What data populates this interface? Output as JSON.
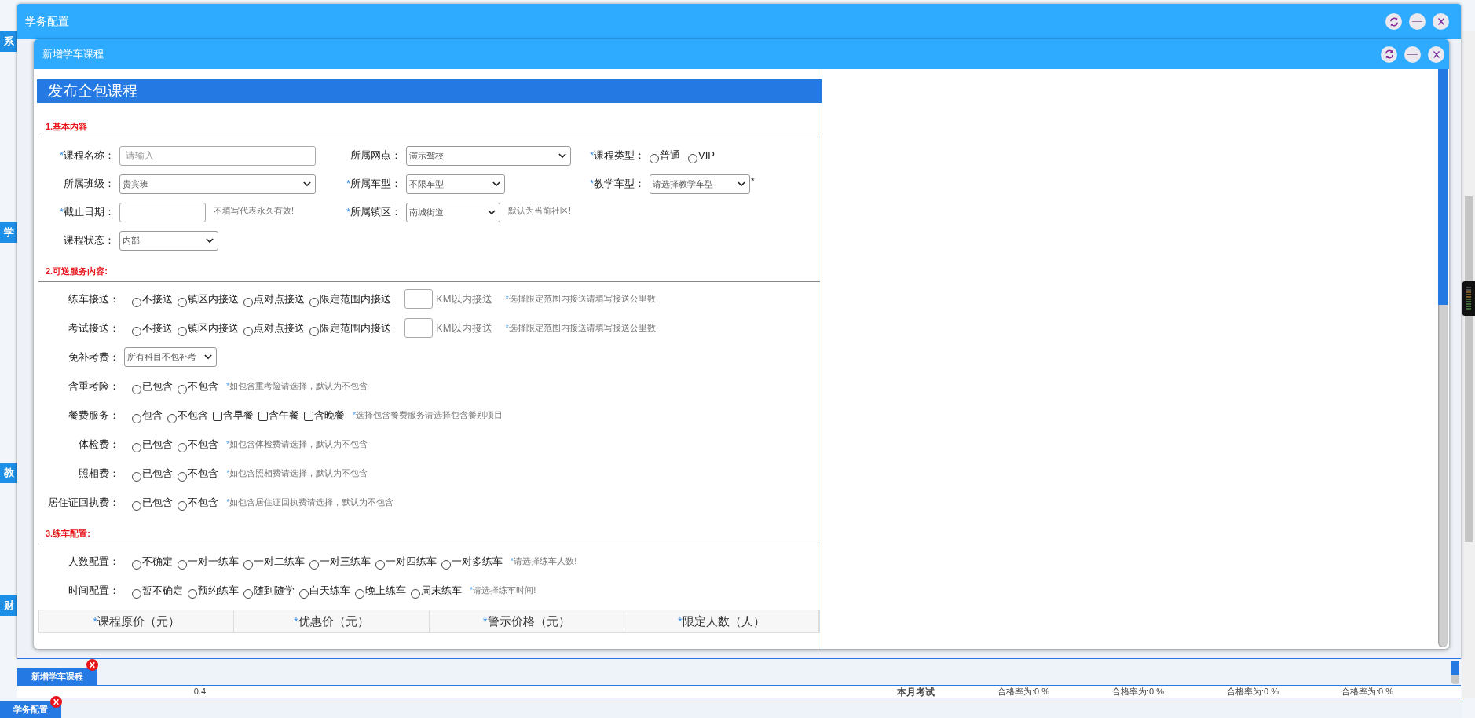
{
  "outer_window": {
    "title": "学务配置"
  },
  "inner_window": {
    "title": "新增学车课程",
    "heading": "发布全包课程",
    "sections": [
      {
        "title": "1.基本内容",
        "rows": [
          {
            "fields": [
              {
                "kind": "input",
                "mark": "*",
                "label": "课程名称：",
                "placeholder": "请输入"
              },
              {
                "kind": "select",
                "label": "所属网点：",
                "value": "演示驾校"
              },
              {
                "kind": "choice",
                "mark": "*",
                "label": "课程类型：",
                "options": [
                  {
                    "kind": "radio",
                    "label": "普通",
                    "selected": false
                  },
                  {
                    "kind": "radio",
                    "label": "VIP",
                    "selected": false
                  }
                ]
              }
            ]
          },
          {
            "fields": [
              {
                "kind": "select",
                "label": "所属班级：",
                "value": "贵宾班"
              },
              {
                "kind": "select",
                "mark": "*",
                "label": "所属车型：",
                "value": "不限车型"
              },
              {
                "kind": "select",
                "mark": "*",
                "label": "教学车型：",
                "value": "请选择教学车型",
                "suffix": "*"
              }
            ]
          },
          {
            "fields": [
              {
                "kind": "input",
                "mark": "*",
                "label": "截止日期：",
                "hint": {
                  "text": "不填写代表永久有效!"
                }
              },
              {
                "kind": "select",
                "mark": "*",
                "label": "所属镇区：",
                "value": "南城街道",
                "hint": {
                  "text": "默认为当前社区!"
                }
              }
            ]
          },
          {
            "fields": [
              {
                "kind": "select",
                "label": "课程状态：",
                "value": "内部"
              }
            ]
          }
        ]
      },
      {
        "title": "2.可送服务内容:",
        "rows": [
          {
            "fields": [
              {
                "kind": "choice",
                "label": "练车接送：",
                "options": [
                  {
                    "kind": "radio",
                    "label": "不接送",
                    "selected": false
                  },
                  {
                    "kind": "radio",
                    "label": "镇区内接送",
                    "selected": false
                  },
                  {
                    "kind": "radio",
                    "label": "点对点接送",
                    "selected": false
                  },
                  {
                    "kind": "radio",
                    "label": "限定范围内接送",
                    "selected": false
                  }
                ],
                "unit_input": {
                  "unit": "KM以内接送"
                },
                "hint": {
                  "mark": "*",
                  "text": "选择限定范围内接送请填写接送公里数"
                }
              }
            ]
          },
          {
            "fields": [
              {
                "kind": "choice",
                "label": "考试接送：",
                "options": [
                  {
                    "kind": "radio",
                    "label": "不接送",
                    "selected": false
                  },
                  {
                    "kind": "radio",
                    "label": "镇区内接送",
                    "selected": false
                  },
                  {
                    "kind": "radio",
                    "label": "点对点接送",
                    "selected": false
                  },
                  {
                    "kind": "radio",
                    "label": "限定范围内接送",
                    "selected": false
                  }
                ],
                "unit_input": {
                  "unit": "KM以内接送"
                },
                "hint": {
                  "mark": "*",
                  "text": "选择限定范围内接送请填写接送公里数"
                }
              }
            ]
          },
          {
            "fields": [
              {
                "kind": "select",
                "label": "免补考费：",
                "value": "所有科目不包补考"
              }
            ]
          },
          {
            "fields": [
              {
                "kind": "choice",
                "label": "含重考险：",
                "options": [
                  {
                    "kind": "radio",
                    "label": "已包含",
                    "selected": false
                  },
                  {
                    "kind": "radio",
                    "label": "不包含",
                    "selected": false
                  }
                ],
                "hint": {
                  "mark": "*",
                  "text": "如包含重考险请选择，默认为不包含"
                }
              }
            ]
          },
          {
            "fields": [
              {
                "kind": "choice",
                "label": "餐费服务：",
                "options": [
                  {
                    "kind": "radio",
                    "label": "包含",
                    "selected": false
                  },
                  {
                    "kind": "radio",
                    "label": "不包含",
                    "selected": false
                  },
                  {
                    "kind": "checkbox",
                    "label": "含早餐",
                    "checked": false
                  },
                  {
                    "kind": "checkbox",
                    "label": "含午餐",
                    "checked": false
                  },
                  {
                    "kind": "checkbox",
                    "label": "含晚餐",
                    "checked": false
                  }
                ],
                "hint": {
                  "mark": "*",
                  "text": "选择包含餐费服务请选择包含餐别项目"
                }
              }
            ]
          },
          {
            "fields": [
              {
                "kind": "choice",
                "label": "体检费：",
                "options": [
                  {
                    "kind": "radio",
                    "label": "已包含",
                    "selected": false
                  },
                  {
                    "kind": "radio",
                    "label": "不包含",
                    "selected": false
                  }
                ],
                "hint": {
                  "mark": "*",
                  "text": "如包含体检费请选择，默认为不包含"
                }
              }
            ]
          },
          {
            "fields": [
              {
                "kind": "choice",
                "label": "照相费：",
                "options": [
                  {
                    "kind": "radio",
                    "label": "已包含",
                    "selected": false
                  },
                  {
                    "kind": "radio",
                    "label": "不包含",
                    "selected": false
                  }
                ],
                "hint": {
                  "mark": "*",
                  "text": "如包含照相费请选择，默认为不包含"
                }
              }
            ]
          },
          {
            "fields": [
              {
                "kind": "choice",
                "label": "居住证回执费：",
                "options": [
                  {
                    "kind": "radio",
                    "label": "已包含",
                    "selected": false
                  },
                  {
                    "kind": "radio",
                    "label": "不包含",
                    "selected": false
                  }
                ],
                "hint": {
                  "mark": "*",
                  "text": "如包含居住证回执费请选择，默认为不包含"
                }
              }
            ]
          }
        ]
      },
      {
        "title": "3.练车配置:",
        "rows": [
          {
            "fields": [
              {
                "kind": "choice",
                "label": "人数配置：",
                "options": [
                  {
                    "kind": "radio",
                    "label": "不确定",
                    "selected": false
                  },
                  {
                    "kind": "radio",
                    "label": "一对一练车",
                    "selected": false
                  },
                  {
                    "kind": "radio",
                    "label": "一对二练车",
                    "selected": false
                  },
                  {
                    "kind": "radio",
                    "label": "一对三练车",
                    "selected": false
                  },
                  {
                    "kind": "radio",
                    "label": "一对四练车",
                    "selected": false
                  },
                  {
                    "kind": "radio",
                    "label": "一对多练车",
                    "selected": false
                  }
                ],
                "hint": {
                  "mark": "*",
                  "text": "请选择练车人数!"
                }
              }
            ]
          },
          {
            "fields": [
              {
                "kind": "choice",
                "label": "时间配置：",
                "options": [
                  {
                    "kind": "radio",
                    "label": "暂不确定",
                    "selected": false
                  },
                  {
                    "kind": "radio",
                    "label": "预约练车",
                    "selected": false
                  },
                  {
                    "kind": "radio",
                    "label": "随到随学",
                    "selected": false
                  },
                  {
                    "kind": "radio",
                    "label": "白天练车",
                    "selected": false
                  },
                  {
                    "kind": "radio",
                    "label": "晚上练车",
                    "selected": false
                  },
                  {
                    "kind": "radio",
                    "label": "周末练车",
                    "selected": false
                  }
                ],
                "hint": {
                  "mark": "*",
                  "text": "请选择练车时间!"
                }
              }
            ]
          }
        ]
      }
    ],
    "price_table": {
      "columns": [
        {
          "mark": "*",
          "label": "课程原价（元）"
        },
        {
          "mark": "*",
          "label": "优惠价（元）"
        },
        {
          "mark": "*",
          "label": "警示价格（元）"
        },
        {
          "mark": "*",
          "label": "限定人数（人）"
        }
      ]
    }
  },
  "outer_taskbar": {
    "tabs": [
      {
        "label": "新增学车课程",
        "selected": true
      }
    ]
  },
  "page_taskbar": {
    "tabs": [
      {
        "label": "学务配置",
        "selected": true
      }
    ]
  },
  "background": {
    "side_tabs": [
      "系",
      "学",
      "教",
      "财"
    ],
    "chart_tick": "0.4",
    "stats_title": "本月考试",
    "stats": [
      "合格率为:0 %",
      "合格率为:0 %",
      "合格率为:0 %",
      "合格率为:0 %"
    ]
  }
}
